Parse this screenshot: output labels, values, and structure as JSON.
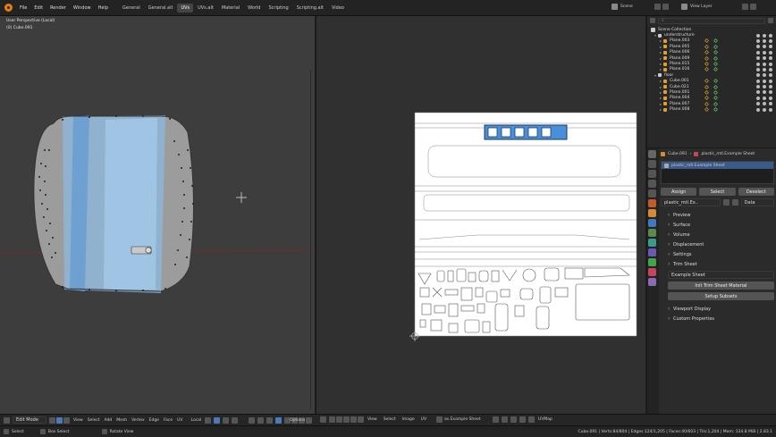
{
  "menu": [
    "File",
    "Edit",
    "Render",
    "Window",
    "Help"
  ],
  "workspaces": [
    "General",
    "General.alt",
    "UVs",
    "UVs.alt",
    "Material",
    "World",
    "Scripting",
    "Scripting.alt",
    "Video"
  ],
  "active_workspace": "UVs",
  "scene": "Scene",
  "view_layer": "View Layer",
  "viewport": {
    "view_name": "User Perspective (Local)",
    "object_name": "(0) Cube.091"
  },
  "outliner": {
    "root": "Scene Collection",
    "rows": [
      {
        "name": "understructure",
        "kind": "collection"
      },
      {
        "name": "Plane.003",
        "kind": "object"
      },
      {
        "name": "Plane.005",
        "kind": "object"
      },
      {
        "name": "Plane.006",
        "kind": "object"
      },
      {
        "name": "Plane.009",
        "kind": "object"
      },
      {
        "name": "Plane.015",
        "kind": "object"
      },
      {
        "name": "Plane.016",
        "kind": "object"
      },
      {
        "name": "floor",
        "kind": "collection"
      },
      {
        "name": "Cube.001",
        "kind": "object"
      },
      {
        "name": "Cube.021",
        "kind": "object"
      },
      {
        "name": "Plane.001",
        "kind": "object"
      },
      {
        "name": "Plane.004",
        "kind": "object"
      },
      {
        "name": "Plane.007",
        "kind": "object"
      },
      {
        "name": "Plane.008",
        "kind": "object"
      }
    ]
  },
  "properties": {
    "object": "Cube.091",
    "material_breadcrumb": "plastic_mtl.Example Sheet",
    "slot": "plastic_mtl.Example Sheet",
    "assign": "Assign",
    "select": "Select",
    "deselect": "Deselect",
    "material_field": "plastic_mtl.Ex..",
    "data": "Data",
    "panels": [
      "Preview",
      "Surface",
      "Volume",
      "Displacement",
      "Settings",
      "Trim Sheet"
    ],
    "trim_sheet_name": "Example Sheet",
    "init_button": "Init Trim Sheet Material",
    "setup_button": "Setup Subsets",
    "panels_after": [
      "Viewport Display",
      "Custom Properties"
    ]
  },
  "bottom_left": {
    "mode": "Edit Mode",
    "menus": [
      "View",
      "Select",
      "Add",
      "Mesh",
      "Vertex",
      "Edge",
      "Face",
      "UV"
    ],
    "pivot": "Local",
    "options": "Options"
  },
  "bottom_right": {
    "menus": [
      "View",
      "Select",
      "Image",
      "UV"
    ],
    "image": "as.Example Sheet",
    "uvmap": "UVMap"
  },
  "status": {
    "select": "Select",
    "box_select": "Box Select",
    "rotate_view": "Rotate View",
    "stats": "Cube.091 | Verts:84/804 | Edges:124/1,205 | Faces:40/603 | Tris:1,204 | Mem: 334.8 MiB | 2.83.1"
  },
  "colors": {
    "accent": "#e87d0d",
    "selection": "#4a90d9",
    "uv_sheet_bg": "#ffffff"
  }
}
